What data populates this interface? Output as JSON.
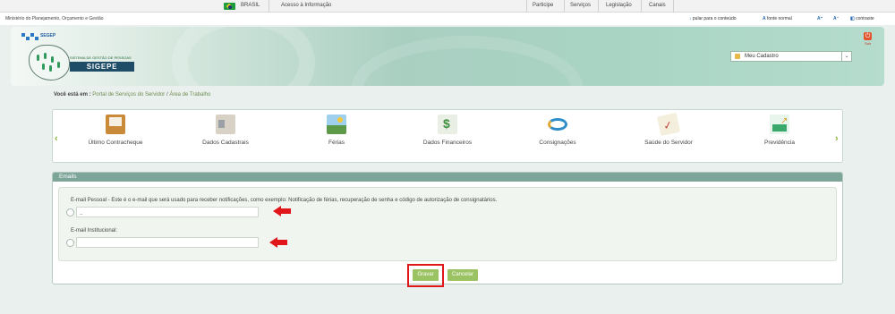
{
  "govbar": {
    "country": "BRASIL",
    "access_info": "Acesso à Informação",
    "menu": [
      "Participe",
      "Serviços",
      "Legislação",
      "Canais"
    ]
  },
  "accbar": {
    "ministry": "Ministério do Planejamento, Orçamento e Gestão",
    "skip": "pular para o conteúdo",
    "font_normal": "fonte normal",
    "font_up": "A⁺",
    "font_down": "A⁻",
    "contrast": "contraste"
  },
  "header": {
    "gov_logo": "SEGEP",
    "system_name": "SISTEMA DE GESTÃO DE PESSOAS",
    "brand": "SIGEPE",
    "logout_label": "Sair",
    "profile_select": "Meu Cadastro"
  },
  "breadcrumb": {
    "prefix": "Você está em :",
    "items": [
      "Portal de Serviços do Servidor",
      "Área de Trabalho"
    ],
    "separator": "/"
  },
  "services": [
    {
      "label": "Último Contracheque",
      "icon": "folder-icon",
      "color": "#c98a3a"
    },
    {
      "label": "Dados Cadastrais",
      "icon": "id-cards-icon",
      "color": "#c9c2b4"
    },
    {
      "label": "Férias",
      "icon": "landscape-icon",
      "color": "#5c9a4a"
    },
    {
      "label": "Dados Financeiros",
      "icon": "money-icon",
      "color": "#3f8f3f"
    },
    {
      "label": "Consignações",
      "icon": "handshake-icon",
      "color": "#2f8ec9"
    },
    {
      "label": "Saúde do Servidor",
      "icon": "health-check-icon",
      "color": "#c24040"
    },
    {
      "label": "Previdência",
      "icon": "growth-chart-icon",
      "color": "#3aa86b"
    }
  ],
  "email_panel": {
    "title": "Emails",
    "personal_desc": "E-mail Pessoal - Este é o e-mail que será usado para receber notificações, como exemplo: Notificação de férias, recuperação de senha e código de autorização de consignatários.",
    "personal_value": "_",
    "institutional_desc": "E-mail Institucional:",
    "institutional_value": "",
    "save_label": "Gravar",
    "cancel_label": "Cancelar"
  },
  "colors": {
    "accent_green": "#9cc363",
    "panel_header": "#7ea59a",
    "annotation_red": "#e0161b"
  }
}
